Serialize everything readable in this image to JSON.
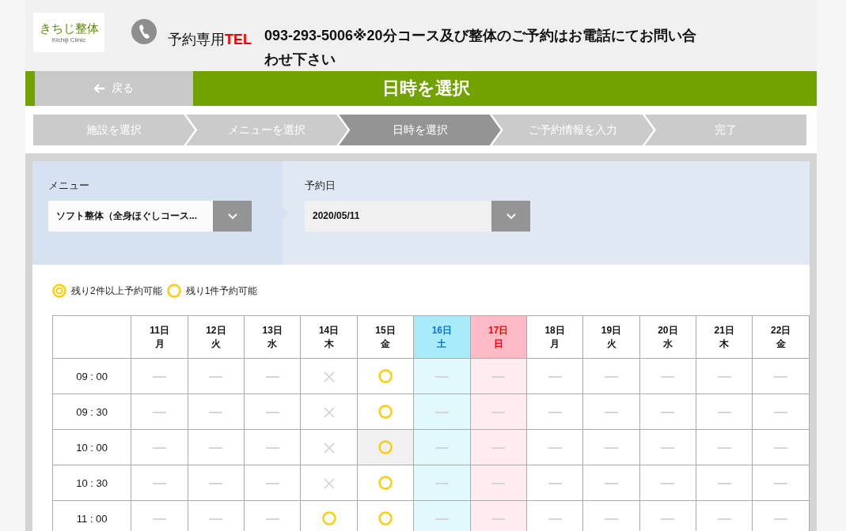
{
  "header": {
    "logo": {
      "name": "きちじ整体",
      "subtitle": "Kichiji Clinic"
    },
    "tel_label": "予約専用",
    "tel_mark": "TEL",
    "notice": "093-293-5006※20分コース及び整体のご予約はお電話にてお問い合わせ下さい"
  },
  "title_bar": {
    "back": "戻る",
    "title": "日時を選択"
  },
  "steps": [
    {
      "label": "施設を選択",
      "selected": false
    },
    {
      "label": "メニューを選択",
      "selected": false
    },
    {
      "label": "日時を選択",
      "selected": true
    },
    {
      "label": "ご予約情報を入力",
      "selected": false
    },
    {
      "label": "完了",
      "selected": false
    }
  ],
  "filters": [
    {
      "label": "メニュー",
      "value": "ソフト整体（全身ほぐしコース..."
    },
    {
      "label": "予約日",
      "value": "2020/05/11"
    }
  ],
  "legend": [
    {
      "kind": "double",
      "label": "残り2件以上予約可能"
    },
    {
      "kind": "single",
      "label": "残り1件予約可能"
    }
  ],
  "days": [
    {
      "date": "11日",
      "weekday": "月",
      "kind": "weekday"
    },
    {
      "date": "12日",
      "weekday": "火",
      "kind": "weekday"
    },
    {
      "date": "13日",
      "weekday": "水",
      "kind": "weekday"
    },
    {
      "date": "14日",
      "weekday": "木",
      "kind": "weekday"
    },
    {
      "date": "15日",
      "weekday": "金",
      "kind": "weekday"
    },
    {
      "date": "16日",
      "weekday": "土",
      "kind": "saturday"
    },
    {
      "date": "17日",
      "weekday": "日",
      "kind": "sunday"
    },
    {
      "date": "18日",
      "weekday": "月",
      "kind": "weekday"
    },
    {
      "date": "19日",
      "weekday": "火",
      "kind": "weekday"
    },
    {
      "date": "20日",
      "weekday": "水",
      "kind": "weekday"
    },
    {
      "date": "21日",
      "weekday": "木",
      "kind": "weekday"
    },
    {
      "date": "22日",
      "weekday": "金",
      "kind": "weekday"
    }
  ],
  "rows": [
    {
      "time": "09 : 00",
      "cells": [
        {
          "kind": "none",
          "selected": false
        },
        {
          "kind": "none",
          "selected": false
        },
        {
          "kind": "none",
          "selected": false
        },
        {
          "kind": "full",
          "selected": false
        },
        {
          "kind": "single",
          "selected": false
        },
        {
          "kind": "none",
          "selected": false
        },
        {
          "kind": "none",
          "selected": false
        },
        {
          "kind": "none",
          "selected": false
        },
        {
          "kind": "none",
          "selected": false
        },
        {
          "kind": "none",
          "selected": false
        },
        {
          "kind": "none",
          "selected": false
        },
        {
          "kind": "none",
          "selected": false
        }
      ]
    },
    {
      "time": "09 : 30",
      "cells": [
        {
          "kind": "none",
          "selected": false
        },
        {
          "kind": "none",
          "selected": false
        },
        {
          "kind": "none",
          "selected": false
        },
        {
          "kind": "full",
          "selected": false
        },
        {
          "kind": "single",
          "selected": false
        },
        {
          "kind": "none",
          "selected": false
        },
        {
          "kind": "none",
          "selected": false
        },
        {
          "kind": "none",
          "selected": false
        },
        {
          "kind": "none",
          "selected": false
        },
        {
          "kind": "none",
          "selected": false
        },
        {
          "kind": "none",
          "selected": false
        },
        {
          "kind": "none",
          "selected": false
        }
      ]
    },
    {
      "time": "10 : 00",
      "cells": [
        {
          "kind": "none",
          "selected": false
        },
        {
          "kind": "none",
          "selected": false
        },
        {
          "kind": "none",
          "selected": false
        },
        {
          "kind": "full",
          "selected": false
        },
        {
          "kind": "single",
          "selected": true
        },
        {
          "kind": "none",
          "selected": false
        },
        {
          "kind": "none",
          "selected": false
        },
        {
          "kind": "none",
          "selected": false
        },
        {
          "kind": "none",
          "selected": false
        },
        {
          "kind": "none",
          "selected": false
        },
        {
          "kind": "none",
          "selected": false
        },
        {
          "kind": "none",
          "selected": false
        }
      ]
    },
    {
      "time": "10 : 30",
      "cells": [
        {
          "kind": "none",
          "selected": false
        },
        {
          "kind": "none",
          "selected": false
        },
        {
          "kind": "none",
          "selected": false
        },
        {
          "kind": "full",
          "selected": false
        },
        {
          "kind": "single",
          "selected": false
        },
        {
          "kind": "none",
          "selected": false
        },
        {
          "kind": "none",
          "selected": false
        },
        {
          "kind": "none",
          "selected": false
        },
        {
          "kind": "none",
          "selected": false
        },
        {
          "kind": "none",
          "selected": false
        },
        {
          "kind": "none",
          "selected": false
        },
        {
          "kind": "none",
          "selected": false
        }
      ]
    },
    {
      "time": "11 : 00",
      "cells": [
        {
          "kind": "none",
          "selected": false
        },
        {
          "kind": "none",
          "selected": false
        },
        {
          "kind": "none",
          "selected": false
        },
        {
          "kind": "single",
          "selected": false
        },
        {
          "kind": "single",
          "selected": false
        },
        {
          "kind": "none",
          "selected": false
        },
        {
          "kind": "none",
          "selected": false
        },
        {
          "kind": "none",
          "selected": false
        },
        {
          "kind": "none",
          "selected": false
        },
        {
          "kind": "none",
          "selected": false
        },
        {
          "kind": "none",
          "selected": false
        },
        {
          "kind": "none",
          "selected": false
        }
      ]
    }
  ]
}
